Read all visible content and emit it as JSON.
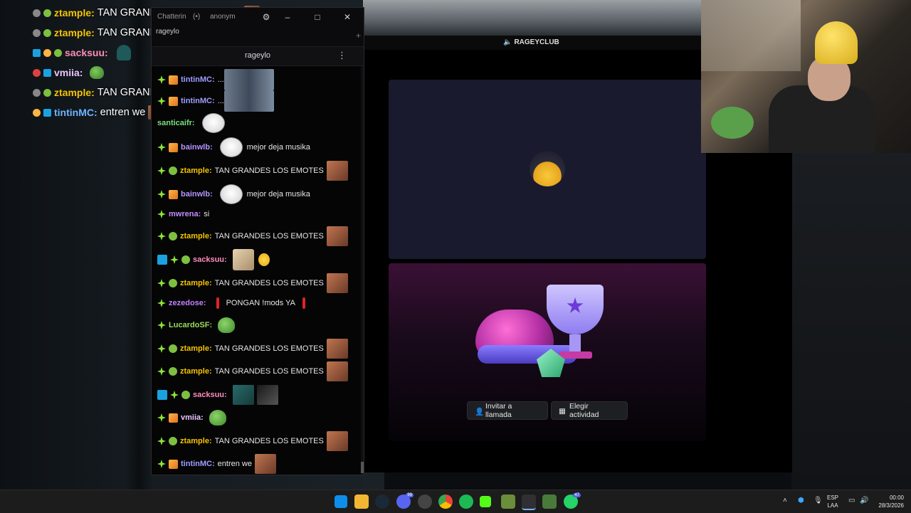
{
  "overlay": {
    "lines": [
      {
        "user": "ztample:",
        "message": "TAN GRANDES LOS EMOTES",
        "color": "#f5c400"
      },
      {
        "user": "ztample:",
        "message": "TAN GRANDES LOS EMOTES",
        "color": "#f5c400"
      },
      {
        "user": "sacksuu:",
        "message": "",
        "color": "#ff8cba"
      },
      {
        "user": "vmiia:",
        "message": "",
        "color": "#e7c6ff"
      },
      {
        "user": "ztample:",
        "message": "TAN GRANDES LOS EMOTES",
        "color": "#f5c400"
      },
      {
        "user": "tintinMC:",
        "message": "entren we",
        "color": "#6fb6ff"
      }
    ]
  },
  "chatterino": {
    "title_tabs": [
      "Chatterin",
      "anonym"
    ],
    "selected_tab": "rageylo",
    "channel": "rageylo",
    "messages": [
      {
        "user": "tintinMC:",
        "text": "...",
        "color": "#9e9eff"
      },
      {
        "user": "tintinMC:",
        "text": "...",
        "color": "#9e9eff"
      },
      {
        "user": "santicaifr:",
        "text": "",
        "color": "#79e07a"
      },
      {
        "user": "bainwlb:",
        "text": "mejor deja musika",
        "color": "#b594ff"
      },
      {
        "user": "ztample:",
        "text": "TAN GRANDES LOS EMOTES",
        "color": "#f5c400"
      },
      {
        "user": "bainwlb:",
        "text": "mejor deja musika",
        "color": "#b594ff"
      },
      {
        "user": "mwrena:",
        "text": "si",
        "color": "#c48cff"
      },
      {
        "user": "ztample:",
        "text": "TAN GRANDES LOS EMOTES",
        "color": "#f5c400"
      },
      {
        "user": "sacksuu:",
        "text": "",
        "color": "#ff8cba"
      },
      {
        "user": "ztample:",
        "text": "TAN GRANDES LOS EMOTES",
        "color": "#f5c400"
      },
      {
        "user": "zezedose:",
        "text": "PONGAN !mods YA",
        "color": "#c080ff"
      },
      {
        "user": "LucardoSF:",
        "text": "",
        "color": "#9bdb5a"
      },
      {
        "user": "ztample:",
        "text": "TAN GRANDES LOS EMOTES",
        "color": "#f5c400"
      },
      {
        "user": "ztample:",
        "text": "TAN GRANDES LOS EMOTES",
        "color": "#f5c400"
      },
      {
        "user": "sacksuu:",
        "text": "",
        "color": "#ff8cba"
      },
      {
        "user": "vmiia:",
        "text": "",
        "color": "#e7c6ff"
      },
      {
        "user": "ztample:",
        "text": "TAN GRANDES LOS EMOTES",
        "color": "#f5c400"
      },
      {
        "user": "tintinMC:",
        "text": "entren we",
        "color": "#9e9eff"
      }
    ]
  },
  "discord": {
    "header_title": "RAGEYCLUB",
    "invite_button": "Invitar a llamada",
    "activity_button": "Elegir actividad"
  },
  "taskbar": {
    "lang_line1": "ESP",
    "lang_line2": "LAA",
    "time": "00:00",
    "date": "28/3/2026",
    "discord_badge": "99",
    "whatsapp_badge": "47"
  }
}
